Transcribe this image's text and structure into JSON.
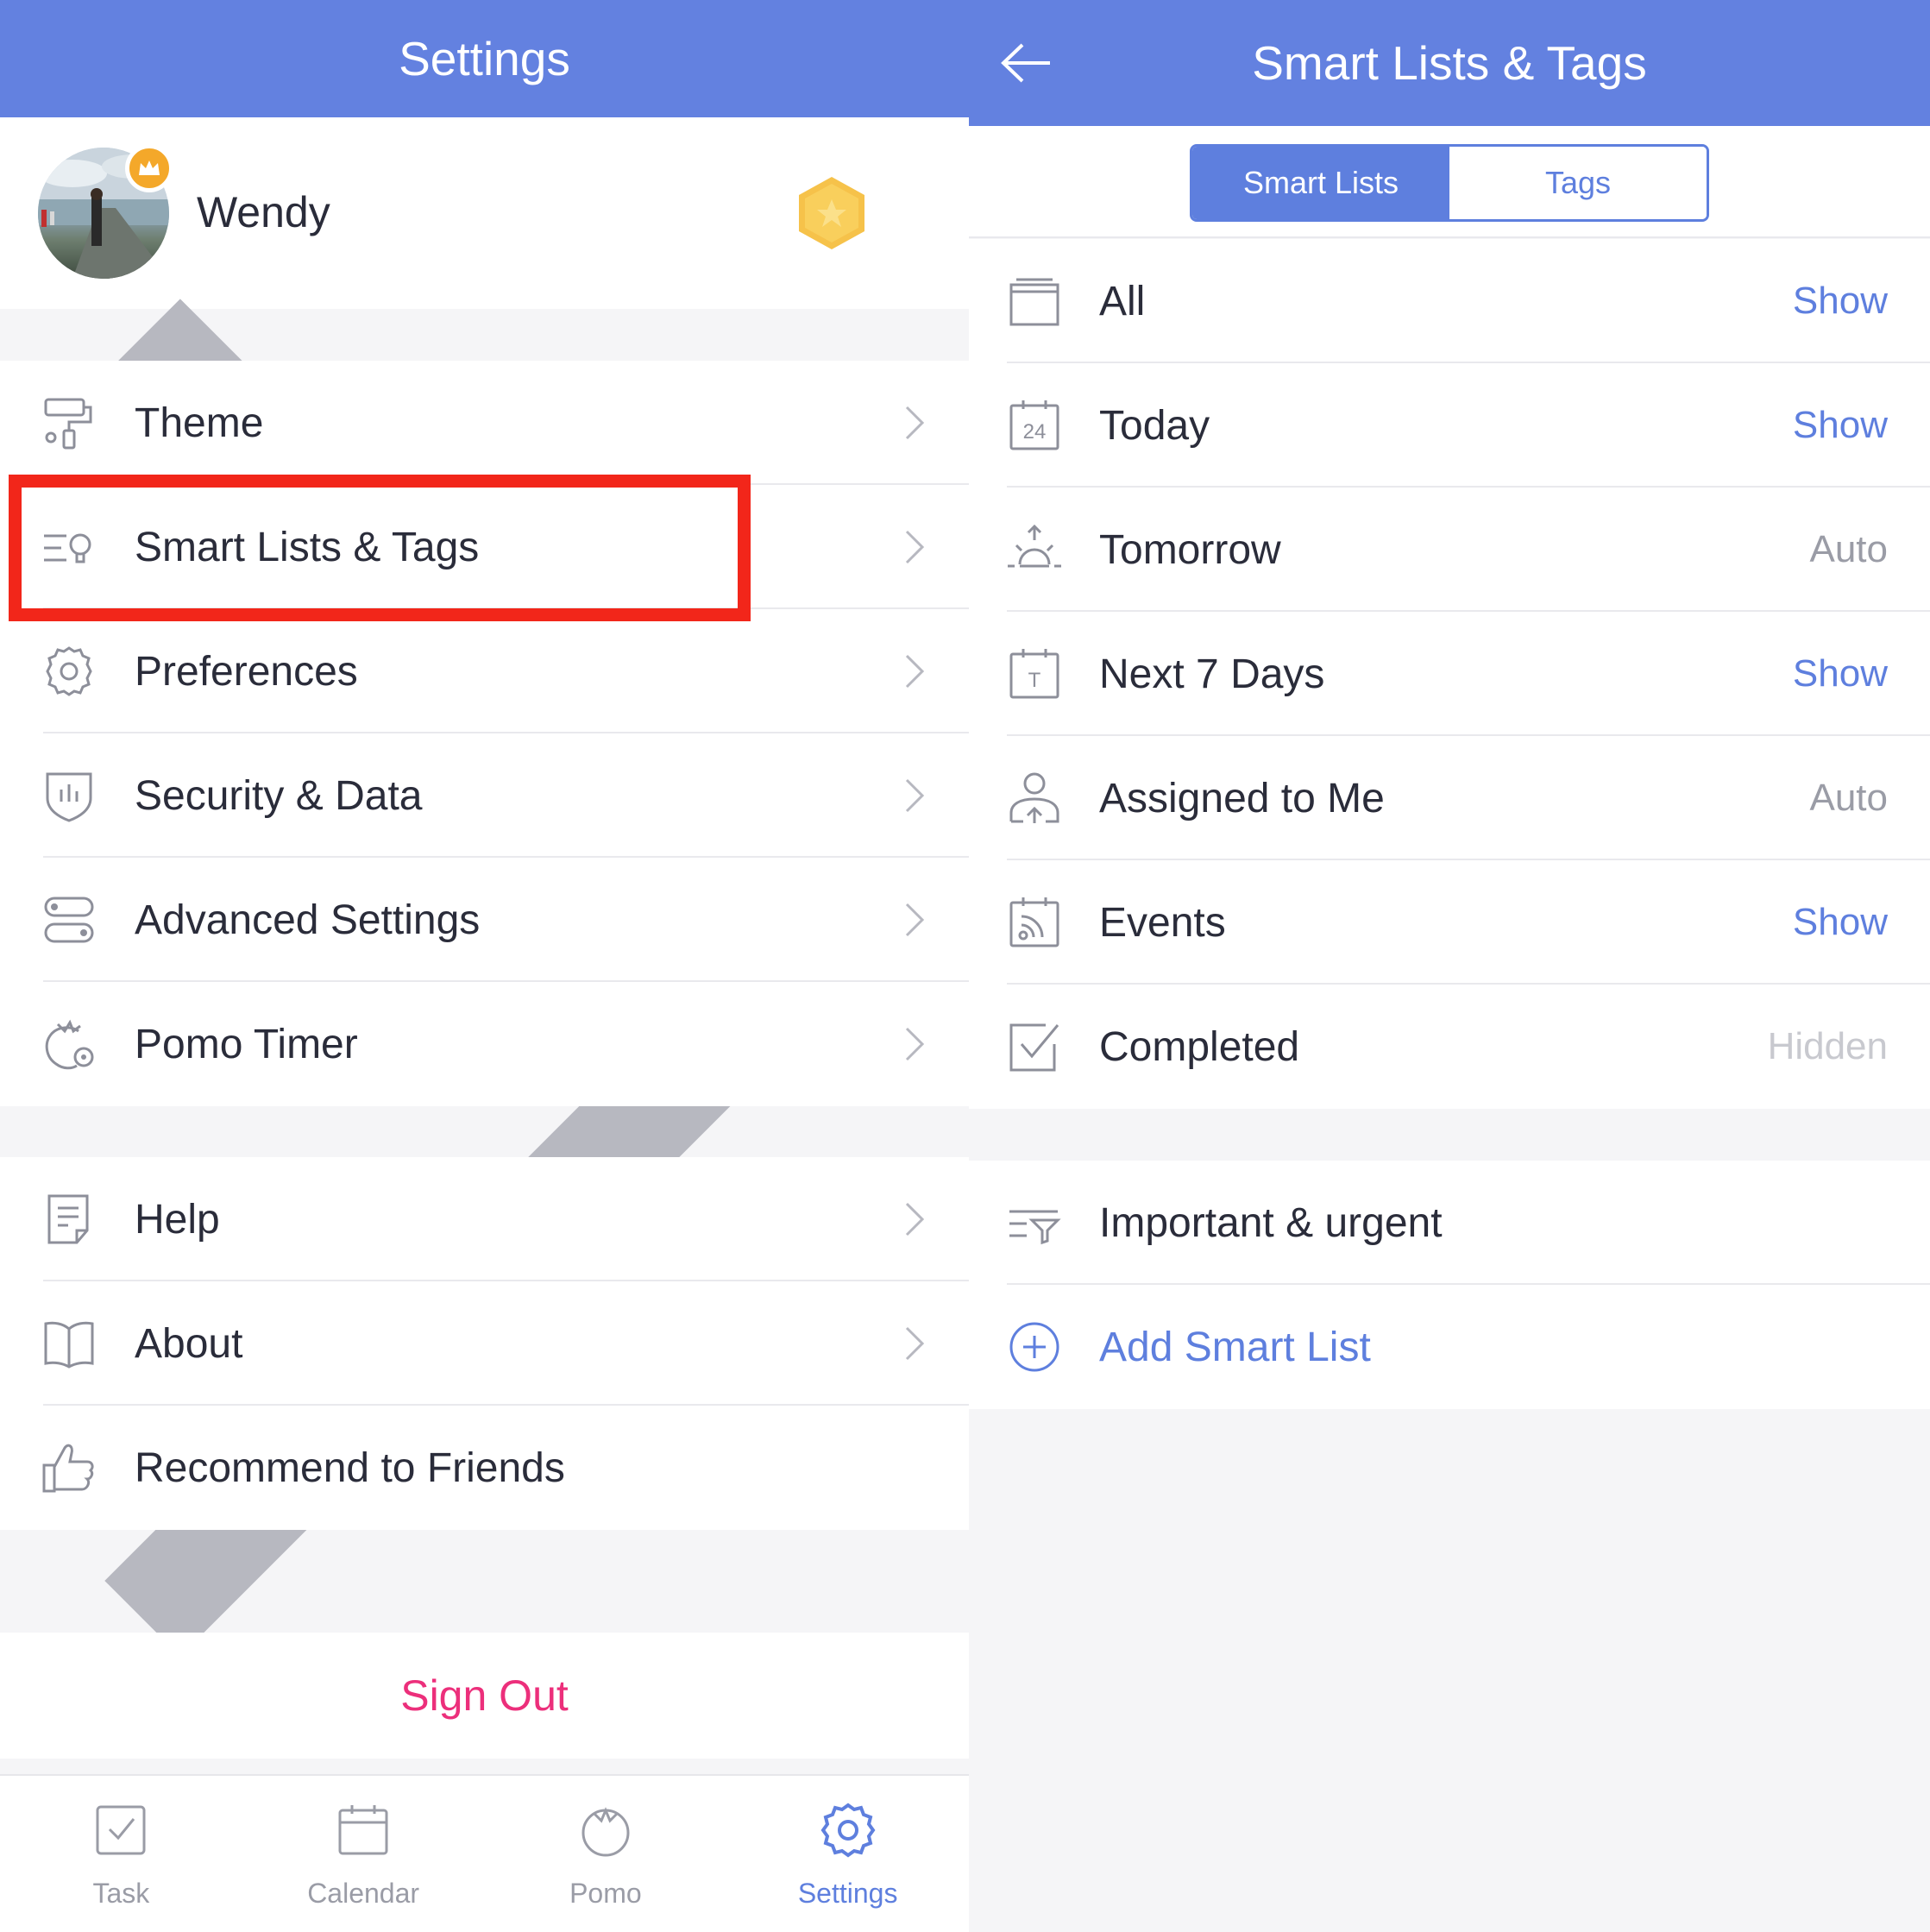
{
  "settings": {
    "title": "Settings",
    "user": {
      "name": "Wendy"
    },
    "menu_group_1": [
      {
        "label": "Theme",
        "icon": "paint-roller-icon"
      },
      {
        "label": "Smart Lists & Tags",
        "icon": "smart-list-icon"
      },
      {
        "label": "Preferences",
        "icon": "gear-icon"
      },
      {
        "label": "Security & Data",
        "icon": "shield-icon"
      },
      {
        "label": "Advanced Settings",
        "icon": "toggles-icon"
      },
      {
        "label": "Pomo Timer",
        "icon": "tomato-gear-icon"
      }
    ],
    "menu_group_2": [
      {
        "label": "Help",
        "icon": "document-icon"
      },
      {
        "label": "About",
        "icon": "book-icon"
      },
      {
        "label": "Recommend to Friends",
        "icon": "thumbs-up-icon"
      }
    ],
    "sign_out": "Sign Out",
    "tabs": [
      {
        "label": "Task",
        "icon": "checkbox-icon"
      },
      {
        "label": "Calendar",
        "icon": "calendar-icon"
      },
      {
        "label": "Pomo",
        "icon": "tomato-icon"
      },
      {
        "label": "Settings",
        "icon": "gear-icon",
        "active": true
      }
    ]
  },
  "smart_lists": {
    "title": "Smart Lists & Tags",
    "segments": [
      "Smart Lists",
      "Tags"
    ],
    "active_segment": "Smart Lists",
    "items": [
      {
        "label": "All",
        "status": "Show",
        "icon": "inbox-icon"
      },
      {
        "label": "Today",
        "status": "Show",
        "icon": "calendar-24-icon",
        "icon_text": "24"
      },
      {
        "label": "Tomorrow",
        "status": "Auto",
        "icon": "sunrise-icon"
      },
      {
        "label": "Next 7 Days",
        "status": "Show",
        "icon": "calendar-t-icon",
        "icon_text": "T"
      },
      {
        "label": "Assigned to Me",
        "status": "Auto",
        "icon": "person-icon"
      },
      {
        "label": "Events",
        "status": "Show",
        "icon": "calendar-feed-icon"
      },
      {
        "label": "Completed",
        "status": "Hidden",
        "icon": "checkbox-icon"
      }
    ],
    "custom": [
      {
        "label": "Important & urgent",
        "icon": "filter-list-icon"
      }
    ],
    "add_label": "Add Smart List"
  },
  "colors": {
    "header": "#6381e0",
    "accent": "#5e7fde",
    "sign_out": "#ec2f7b",
    "highlight": "#f2261a",
    "badge": "#f4a82a"
  }
}
